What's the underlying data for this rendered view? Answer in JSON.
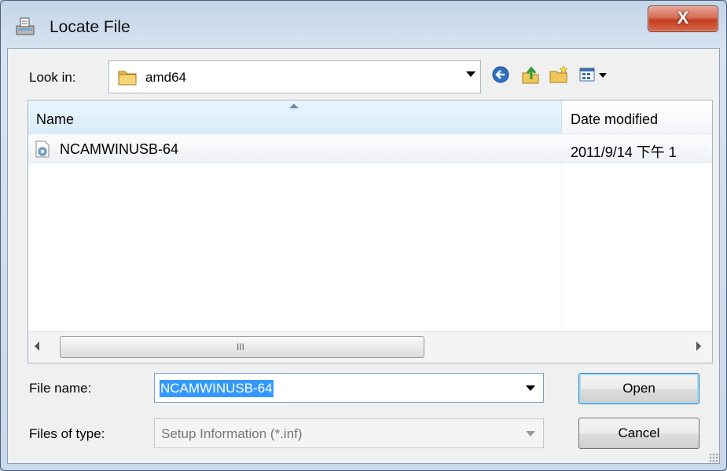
{
  "window": {
    "title": "Locate File",
    "close_glyph": "X"
  },
  "lookin": {
    "label": "Look in:",
    "value": "amd64",
    "icon": "folder-icon"
  },
  "toolbar": {
    "icons": [
      "back-icon",
      "up-folder-icon",
      "new-folder-icon",
      "view-menu-icon"
    ]
  },
  "filelist": {
    "columns": [
      "Name",
      "Date modified"
    ],
    "rows": [
      {
        "name": "NCAMWINUSB-64",
        "date": "2011/9/14 下午 1",
        "icon": "setup-information-file-icon"
      }
    ],
    "scroll_grip": "III"
  },
  "filename": {
    "label": "File name:",
    "value": "NCAMWINUSB-64"
  },
  "filetype": {
    "label": "Files of type:",
    "value": "Setup Information (*.inf)"
  },
  "buttons": {
    "open": "Open",
    "cancel": "Cancel"
  },
  "colors": {
    "selection": "#3399ff",
    "title_close": "#c23e20",
    "frame": "#c4d5e8"
  }
}
